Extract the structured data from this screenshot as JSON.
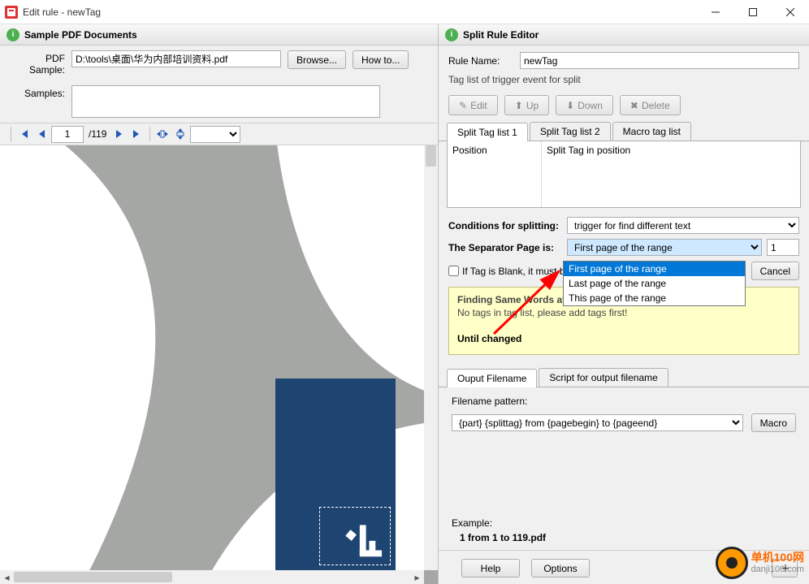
{
  "window": {
    "title": "Edit rule - newTag"
  },
  "left": {
    "header": "Sample PDF Documents",
    "sampleLabel": "PDF Sample:",
    "samplePath": "D:\\tools\\桌面\\华为内部培训资料.pdf",
    "browse": "Browse...",
    "howto": "How to...",
    "samplesLabel": "Samples:",
    "pager": {
      "page": "1",
      "total": "/119"
    }
  },
  "right": {
    "header": "Split Rule Editor",
    "ruleNameLabel": "Rule Name:",
    "ruleName": "newTag",
    "tagListLabel": "Tag list of trigger event for split",
    "btns": {
      "edit": "Edit",
      "up": "Up",
      "down": "Down",
      "delete": "Delete"
    },
    "tabs": {
      "t1": "Split Tag list 1",
      "t2": "Split Tag list 2",
      "t3": "Macro tag list"
    },
    "cols": {
      "pos": "Position",
      "tag": "Split Tag in position"
    },
    "condLabel": "Conditions for splitting:",
    "condValue": "trigger for find different text",
    "sepLabel": "The Separator Page is:",
    "sepValue": "First page of the range",
    "sepNum": "1",
    "sepOptions": [
      "First page of the range",
      "Last page of the range",
      "This page of the range"
    ],
    "blankLabel": "If Tag is Blank, it must be",
    "blankBtn": "Cancel",
    "yellow": {
      "l1": "Finding Same Words at Pos(x,y):",
      "l2": "No tags in tag list, please add tags first!",
      "l3": "Until changed"
    },
    "outTabs": {
      "t1": "Ouput Filename",
      "t2": "Script for output filename"
    },
    "patternLabel": "Filename pattern:",
    "pattern": "{part} {splittag} from {pagebegin} to {pageend}",
    "macroBtn": "Macro",
    "exampleLabel": "Example:",
    "exampleVal": "1  from 1 to 119.pdf",
    "help": "Help",
    "options": "Options"
  },
  "watermark": {
    "line1": "单机100网",
    "line2": "danji100.com"
  }
}
